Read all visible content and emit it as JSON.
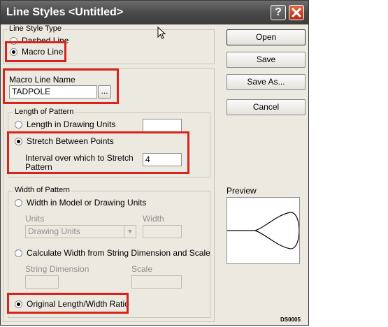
{
  "window": {
    "title": "Line Styles <Untitled>"
  },
  "titlebar": {
    "help_label": "?"
  },
  "line_style_type": {
    "group_title": "Line Style Type",
    "option_dashed": "Dashed Line",
    "option_macro": "Macro Line",
    "selected": "Macro Line"
  },
  "macro_line_name": {
    "label": "Macro Line Name",
    "value": "TADPOLE",
    "browse_label": "..."
  },
  "length_of_pattern": {
    "group_title": "Length of Pattern",
    "option_length": "Length in Drawing Units",
    "length_value": "",
    "option_stretch": "Stretch Between Points",
    "interval_label_1": "Interval over which to Stretch",
    "interval_label_2": "Pattern",
    "interval_value": "4",
    "selected": "Stretch Between Points"
  },
  "width_of_pattern": {
    "group_title": "Width of Pattern",
    "option_model": "Width in Model or Drawing Units",
    "units_label": "Units",
    "units_value": "Drawing Units",
    "width_label": "Width",
    "width_value": "",
    "option_string": "Calculate Width from String Dimension and Scale",
    "string_dimension_label": "String Dimension",
    "string_dimension_value": "",
    "scale_label": "Scale",
    "scale_value": "",
    "option_ratio": "Original Length/Width Ratio",
    "selected": "Original Length/Width Ratio"
  },
  "buttons": {
    "open": "Open",
    "save": "Save",
    "save_as": "Save As...",
    "cancel": "Cancel"
  },
  "preview": {
    "label": "Preview"
  },
  "dialog_code": "DS0005",
  "colors": {
    "highlight": "#d8241c",
    "dialog_bg": "#ece9e0"
  }
}
